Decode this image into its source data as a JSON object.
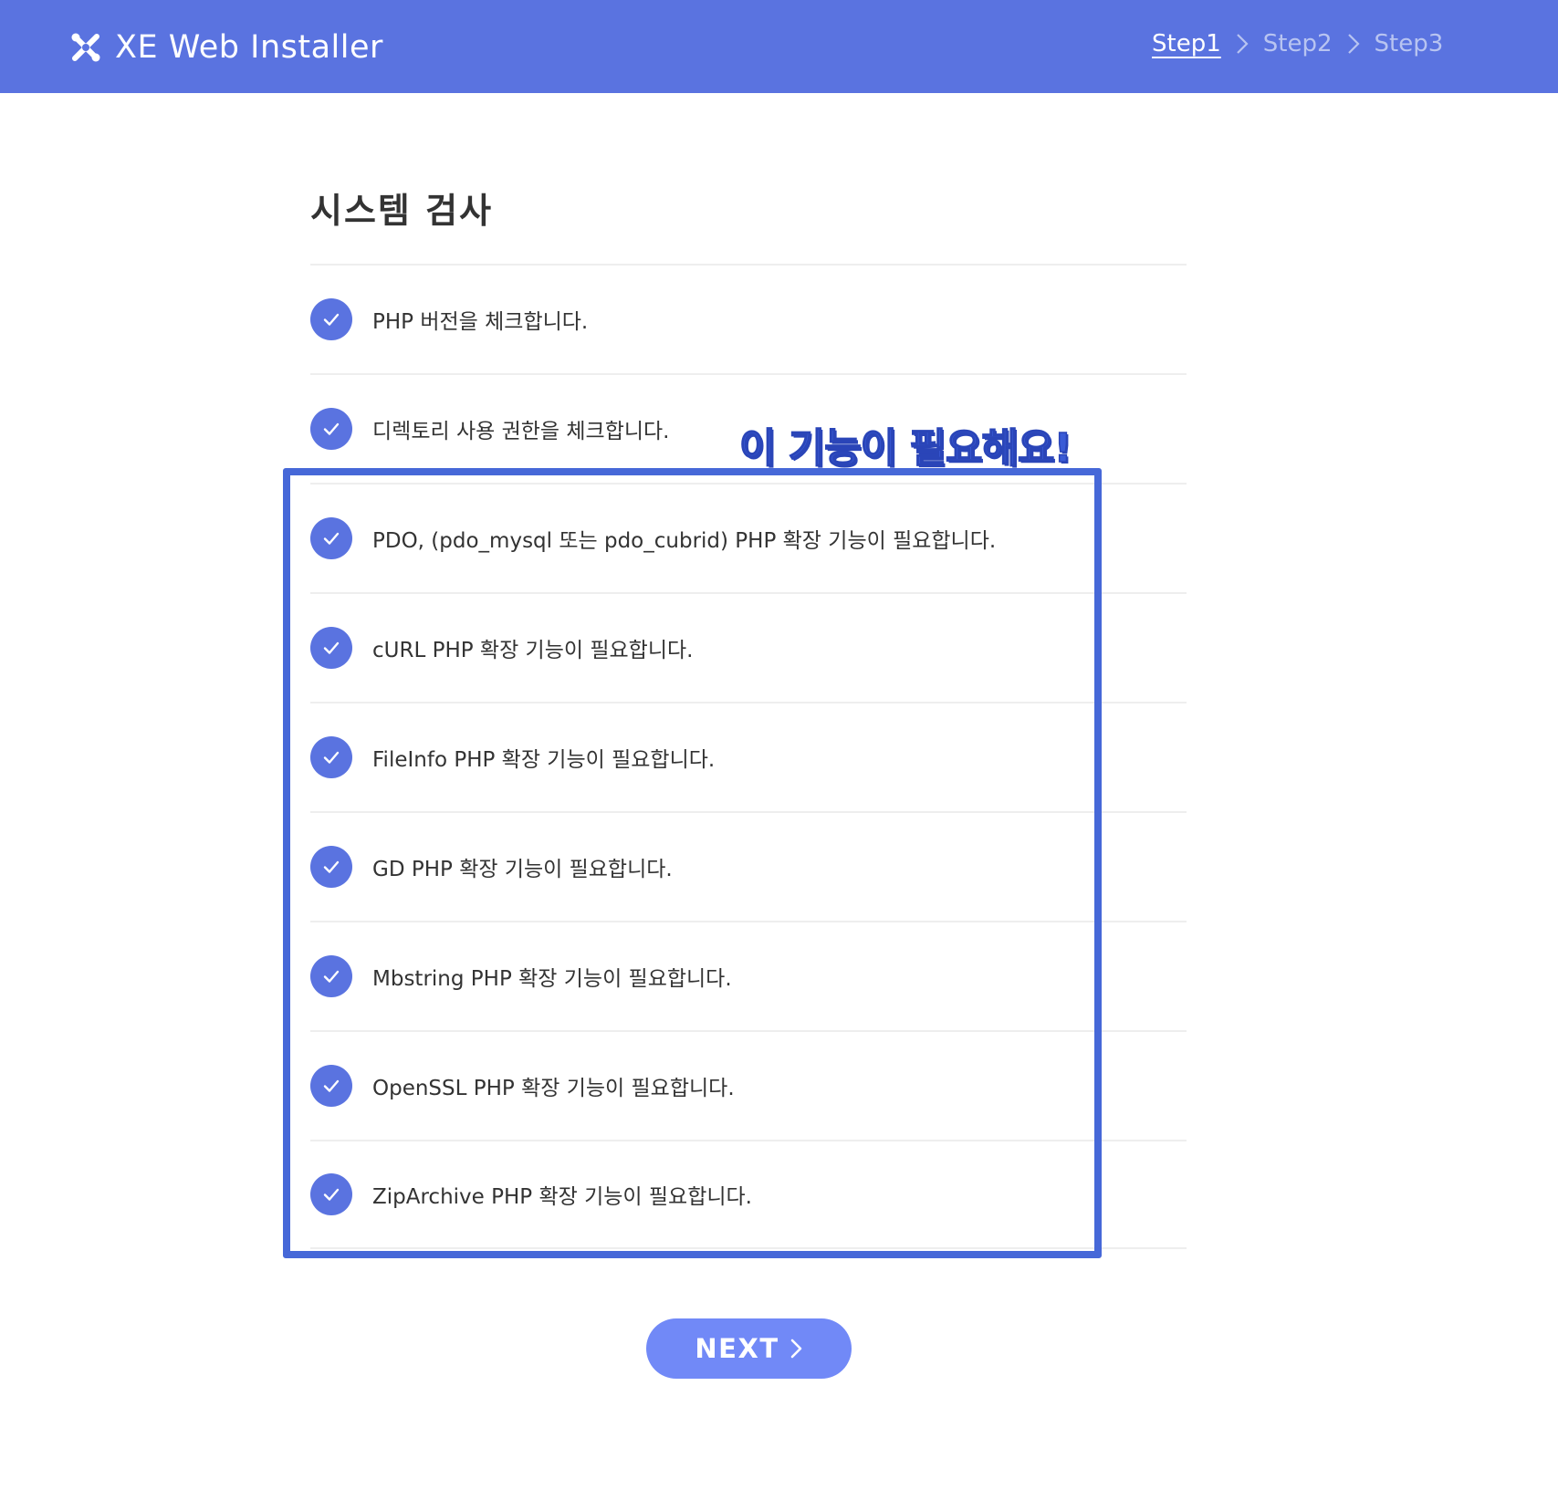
{
  "header": {
    "brand_title": "XE  Web Installer",
    "logo_icon": "xe-logo-icon",
    "steps": [
      {
        "label": "Step1",
        "active": true
      },
      {
        "label": "Step2",
        "active": false
      },
      {
        "label": "Step3",
        "active": false
      }
    ],
    "separator_icon": "chevron-right-icon"
  },
  "main": {
    "title": "시스템 검사",
    "checks": [
      {
        "label": "PHP 버전을 체크합니다.",
        "status": "passed"
      },
      {
        "label": "디렉토리 사용 권한을 체크합니다.",
        "status": "passed"
      },
      {
        "label": "PDO, (pdo_mysql 또는 pdo_cubrid) PHP 확장 기능이 필요합니다.",
        "status": "passed"
      },
      {
        "label": "cURL PHP 확장 기능이 필요합니다.",
        "status": "passed"
      },
      {
        "label": "FileInfo PHP 확장 기능이 필요합니다.",
        "status": "passed"
      },
      {
        "label": "GD PHP 확장 기능이 필요합니다.",
        "status": "passed"
      },
      {
        "label": "Mbstring PHP 확장 기능이 필요합니다.",
        "status": "passed"
      },
      {
        "label": "OpenSSL PHP 확장 기능이 필요합니다.",
        "status": "passed"
      },
      {
        "label": "ZipArchive PHP 확장 기능이 필요합니다.",
        "status": "passed"
      }
    ],
    "check_icon": "checkmark-circle-icon"
  },
  "annotation": {
    "label": "이 기능이 필요해요!",
    "color": "#4668d8"
  },
  "footer": {
    "next_label": "NEXT",
    "next_icon": "chevron-right-icon"
  },
  "colors": {
    "header_bg": "#5a73e0",
    "accent": "#5a73e0",
    "button_bg": "#7189f7",
    "step_inactive": "#b8c4f1"
  }
}
